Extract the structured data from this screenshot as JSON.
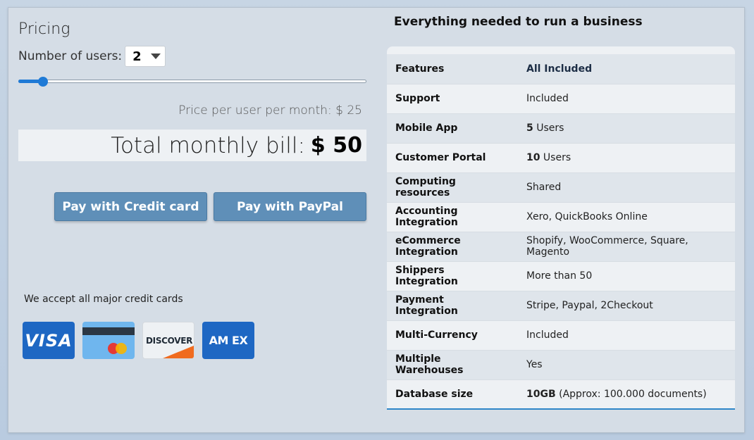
{
  "pricing": {
    "title": "Pricing",
    "users_label": "Number of users:",
    "users_value": "2",
    "slider_level": 0.07,
    "price_per_user": "Price per user per month: $ 25",
    "total_label": "Total monthly bill:",
    "total_amount": "$ 50",
    "pay_credit_label": "Pay with Credit card",
    "pay_paypal_label": "Pay with PayPal",
    "accept_text": "We accept all major credit cards",
    "cards": {
      "visa": "VISA",
      "discover": "DISCOVER",
      "amex": "AM EX"
    }
  },
  "features": {
    "heading": "Everything needed to run a business",
    "rows": [
      {
        "name": "Features",
        "value": "All Included"
      },
      {
        "name": "Support",
        "value": "Included"
      },
      {
        "name": "Mobile App",
        "bold": "5",
        "rest": " Users"
      },
      {
        "name": "Customer Portal",
        "bold": "10",
        "rest": " Users"
      },
      {
        "name": "Computing resources",
        "value": "Shared"
      },
      {
        "name": "Accounting Integration",
        "value": "Xero, QuickBooks Online"
      },
      {
        "name": "eCommerce Integration",
        "value": "Shopify, WooCommerce, Square, Magento"
      },
      {
        "name": "Shippers Integration",
        "value": "More than 50"
      },
      {
        "name": "Payment Integration",
        "value": "Stripe, Paypal, 2Checkout"
      },
      {
        "name": "Multi-Currency",
        "value": "Included"
      },
      {
        "name": "Multiple Warehouses",
        "value": "Yes"
      },
      {
        "name": "Database size",
        "bold": "10GB",
        "rest": " (Approx: 100.000 documents)"
      }
    ]
  },
  "colors": {
    "accent": "#1f7ad6",
    "button": "#5f8fb8",
    "panel_border": "#2f86c8"
  }
}
